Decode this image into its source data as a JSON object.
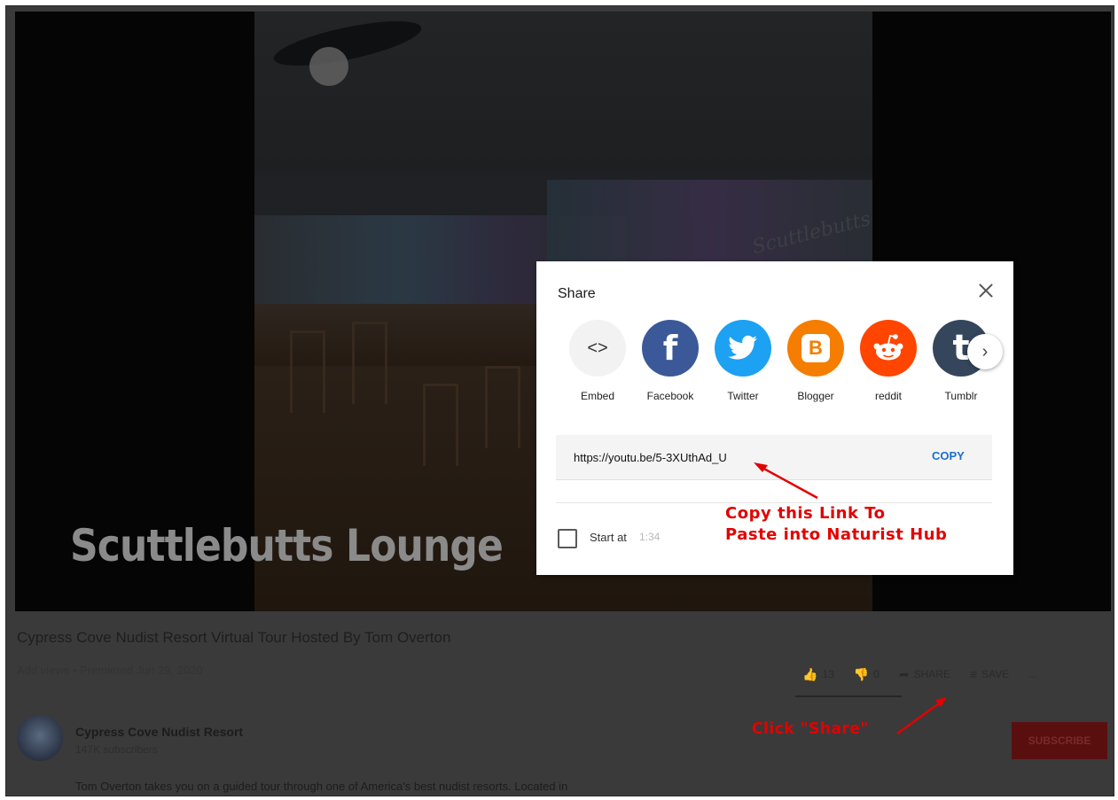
{
  "video": {
    "overlay_title": "Scuttlebutts Lounge",
    "scene_sign": "Scuttlebutts"
  },
  "page": {
    "title": "Cypress Cove Nudist Resort Virtual Tour Hosted By Tom Overton",
    "stats": "Add views • Premiered Jun 29, 2020",
    "actions": {
      "like_count": "13",
      "dislike_count": "0",
      "share_label": "SHARE",
      "save_label": "SAVE",
      "more_label": "..."
    },
    "channel": {
      "name": "Cypress Cove Nudist Resort",
      "subscribers": "147K subscribers",
      "subscribe_label": "SUBSCRIBE"
    },
    "description": "Tom Overton takes you on a guided tour through one of America's best nudist resorts. Located in"
  },
  "share_dialog": {
    "title": "Share",
    "targets": [
      {
        "label": "Embed",
        "icon": "<>",
        "color": "#f2f2f2"
      },
      {
        "label": "Facebook",
        "icon": "f",
        "color": "#3b5998"
      },
      {
        "label": "Twitter",
        "icon": "twitter-bird",
        "color": "#1da1f2"
      },
      {
        "label": "Blogger",
        "icon": "B",
        "color": "#f57d00"
      },
      {
        "label": "reddit",
        "icon": "reddit-alien",
        "color": "#ff4500"
      },
      {
        "label": "Tumblr",
        "icon": "t",
        "color": "#35465c"
      }
    ],
    "next_icon": "›",
    "url": "https://youtu.be/5-3XUthAd_U",
    "copy_label": "COPY",
    "start_at_label": "Start at",
    "start_at_time": "1:34"
  },
  "annotations": {
    "copy_note_line1": "Copy this Link To",
    "copy_note_line2": "Paste into Naturist Hub",
    "share_note": "Click \"Share\"",
    "color": "#e30000"
  }
}
